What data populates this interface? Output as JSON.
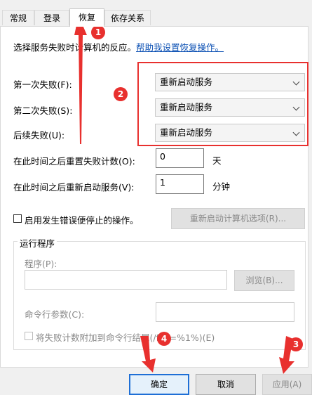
{
  "tabs": [
    {
      "label": "常规"
    },
    {
      "label": "登录"
    },
    {
      "label": "恢复"
    },
    {
      "label": "依存关系"
    }
  ],
  "description": {
    "text": "选择服务失败时计算机的反应。",
    "help_link": "帮助我设置恢复操作。"
  },
  "failures": [
    {
      "label": "第一次失败(F):",
      "value": "重新启动服务"
    },
    {
      "label": "第二次失败(S):",
      "value": "重新启动服务"
    },
    {
      "label": "后续失败(U):",
      "value": "重新启动服务"
    }
  ],
  "reset_count": {
    "label": "在此时间之后重置失败计数(O):",
    "value": "0",
    "unit": "天"
  },
  "restart_service": {
    "label": "在此时间之后重新启动服务(V):",
    "value": "1",
    "unit": "分钟"
  },
  "stop_actions": {
    "checkbox_label": "启用发生错误便停止的操作。",
    "button_label": "重新启动计算机选项(R)..."
  },
  "run_program": {
    "group_title": "运行程序",
    "program_label": "程序(P):",
    "browse_button": "浏览(B)...",
    "cmdline_label": "命令行参数(C):",
    "append_checkbox_label": "将失败计数附加到命令行结尾(/fail=%1%)(E)"
  },
  "footer": {
    "ok": "确定",
    "cancel": "取消",
    "apply": "应用(A)"
  },
  "annotations": [
    "1",
    "2",
    "3",
    "4"
  ],
  "colors": {
    "annotation": "#e8302e",
    "link": "#0a4fb3",
    "focus": "#1e6fd6"
  }
}
